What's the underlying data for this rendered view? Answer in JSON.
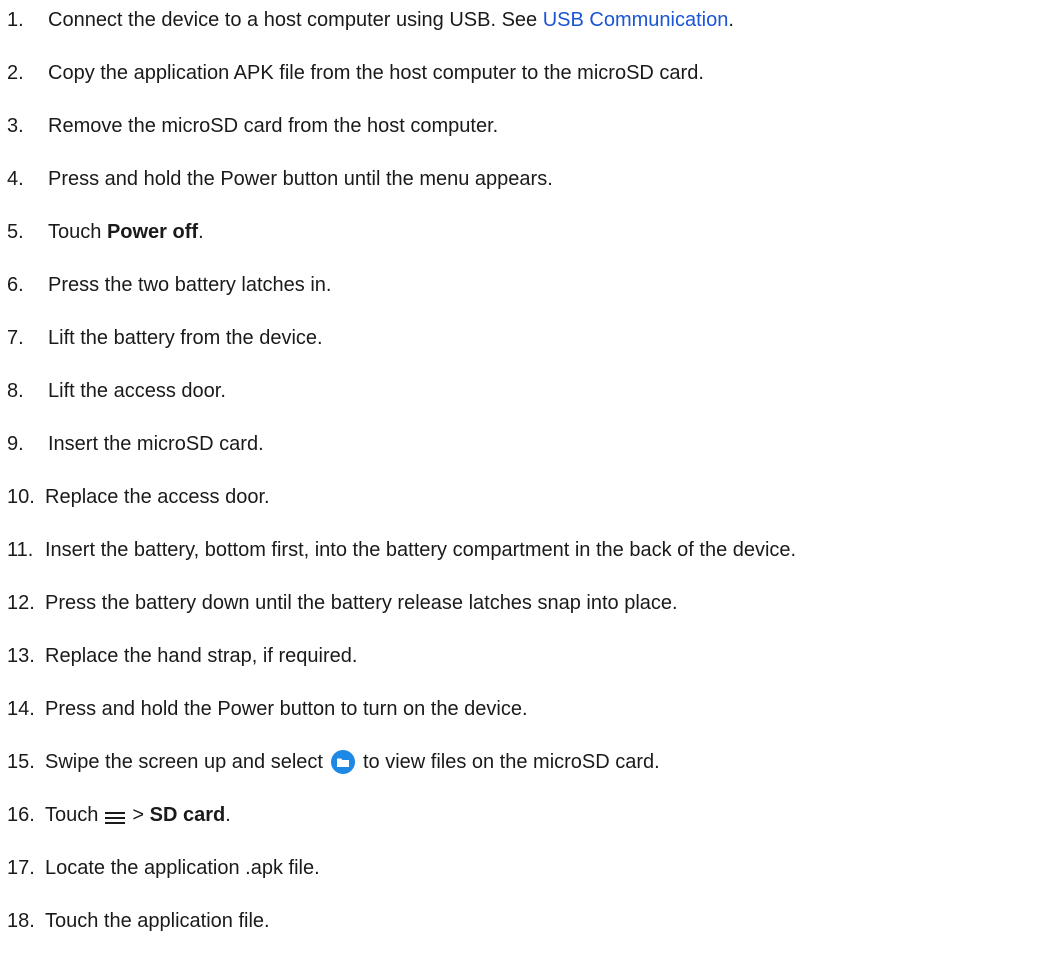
{
  "steps": [
    {
      "num": "1.",
      "parts": [
        "Connect the device to a host computer using USB. See ",
        "USB Communication",
        "."
      ]
    },
    {
      "num": "2.",
      "text": "Copy the application APK file from the host computer to the microSD card."
    },
    {
      "num": "3.",
      "text": "Remove the microSD card from the host computer."
    },
    {
      "num": "4.",
      "text": "Press and hold the Power button until the menu appears."
    },
    {
      "num": "5.",
      "parts": [
        "Touch ",
        "Power off",
        "."
      ]
    },
    {
      "num": "6.",
      "text": "Press the two battery latches in."
    },
    {
      "num": "7.",
      "text": "Lift the battery from the device."
    },
    {
      "num": "8.",
      "text": "Lift the access door."
    },
    {
      "num": "9.",
      "text": "Insert the microSD card."
    },
    {
      "num": "10.",
      "text": "Replace the access door."
    },
    {
      "num": "11.",
      "text": "Insert the battery, bottom first, into the battery compartment in the back of the device."
    },
    {
      "num": "12.",
      "text": "Press the battery down until the battery release latches snap into place."
    },
    {
      "num": "13.",
      "text": "Replace the hand strap, if required."
    },
    {
      "num": "14.",
      "text": "Press and hold the Power button to turn on the device."
    },
    {
      "num": "15.",
      "parts": [
        "Swipe the screen up and select",
        "to view files on the microSD card."
      ],
      "icon": "files-app-icon"
    },
    {
      "num": "16.",
      "parts": [
        "Touch",
        "> ",
        "SD card",
        "."
      ],
      "icon": "menu-icon"
    },
    {
      "num": "17.",
      "text": "Locate the application .apk file."
    },
    {
      "num": "18.",
      "text": "Touch the application file."
    }
  ],
  "colors": {
    "text": "#1a1a1a",
    "link": "#1a55d6",
    "icon": "#1e88e5"
  }
}
